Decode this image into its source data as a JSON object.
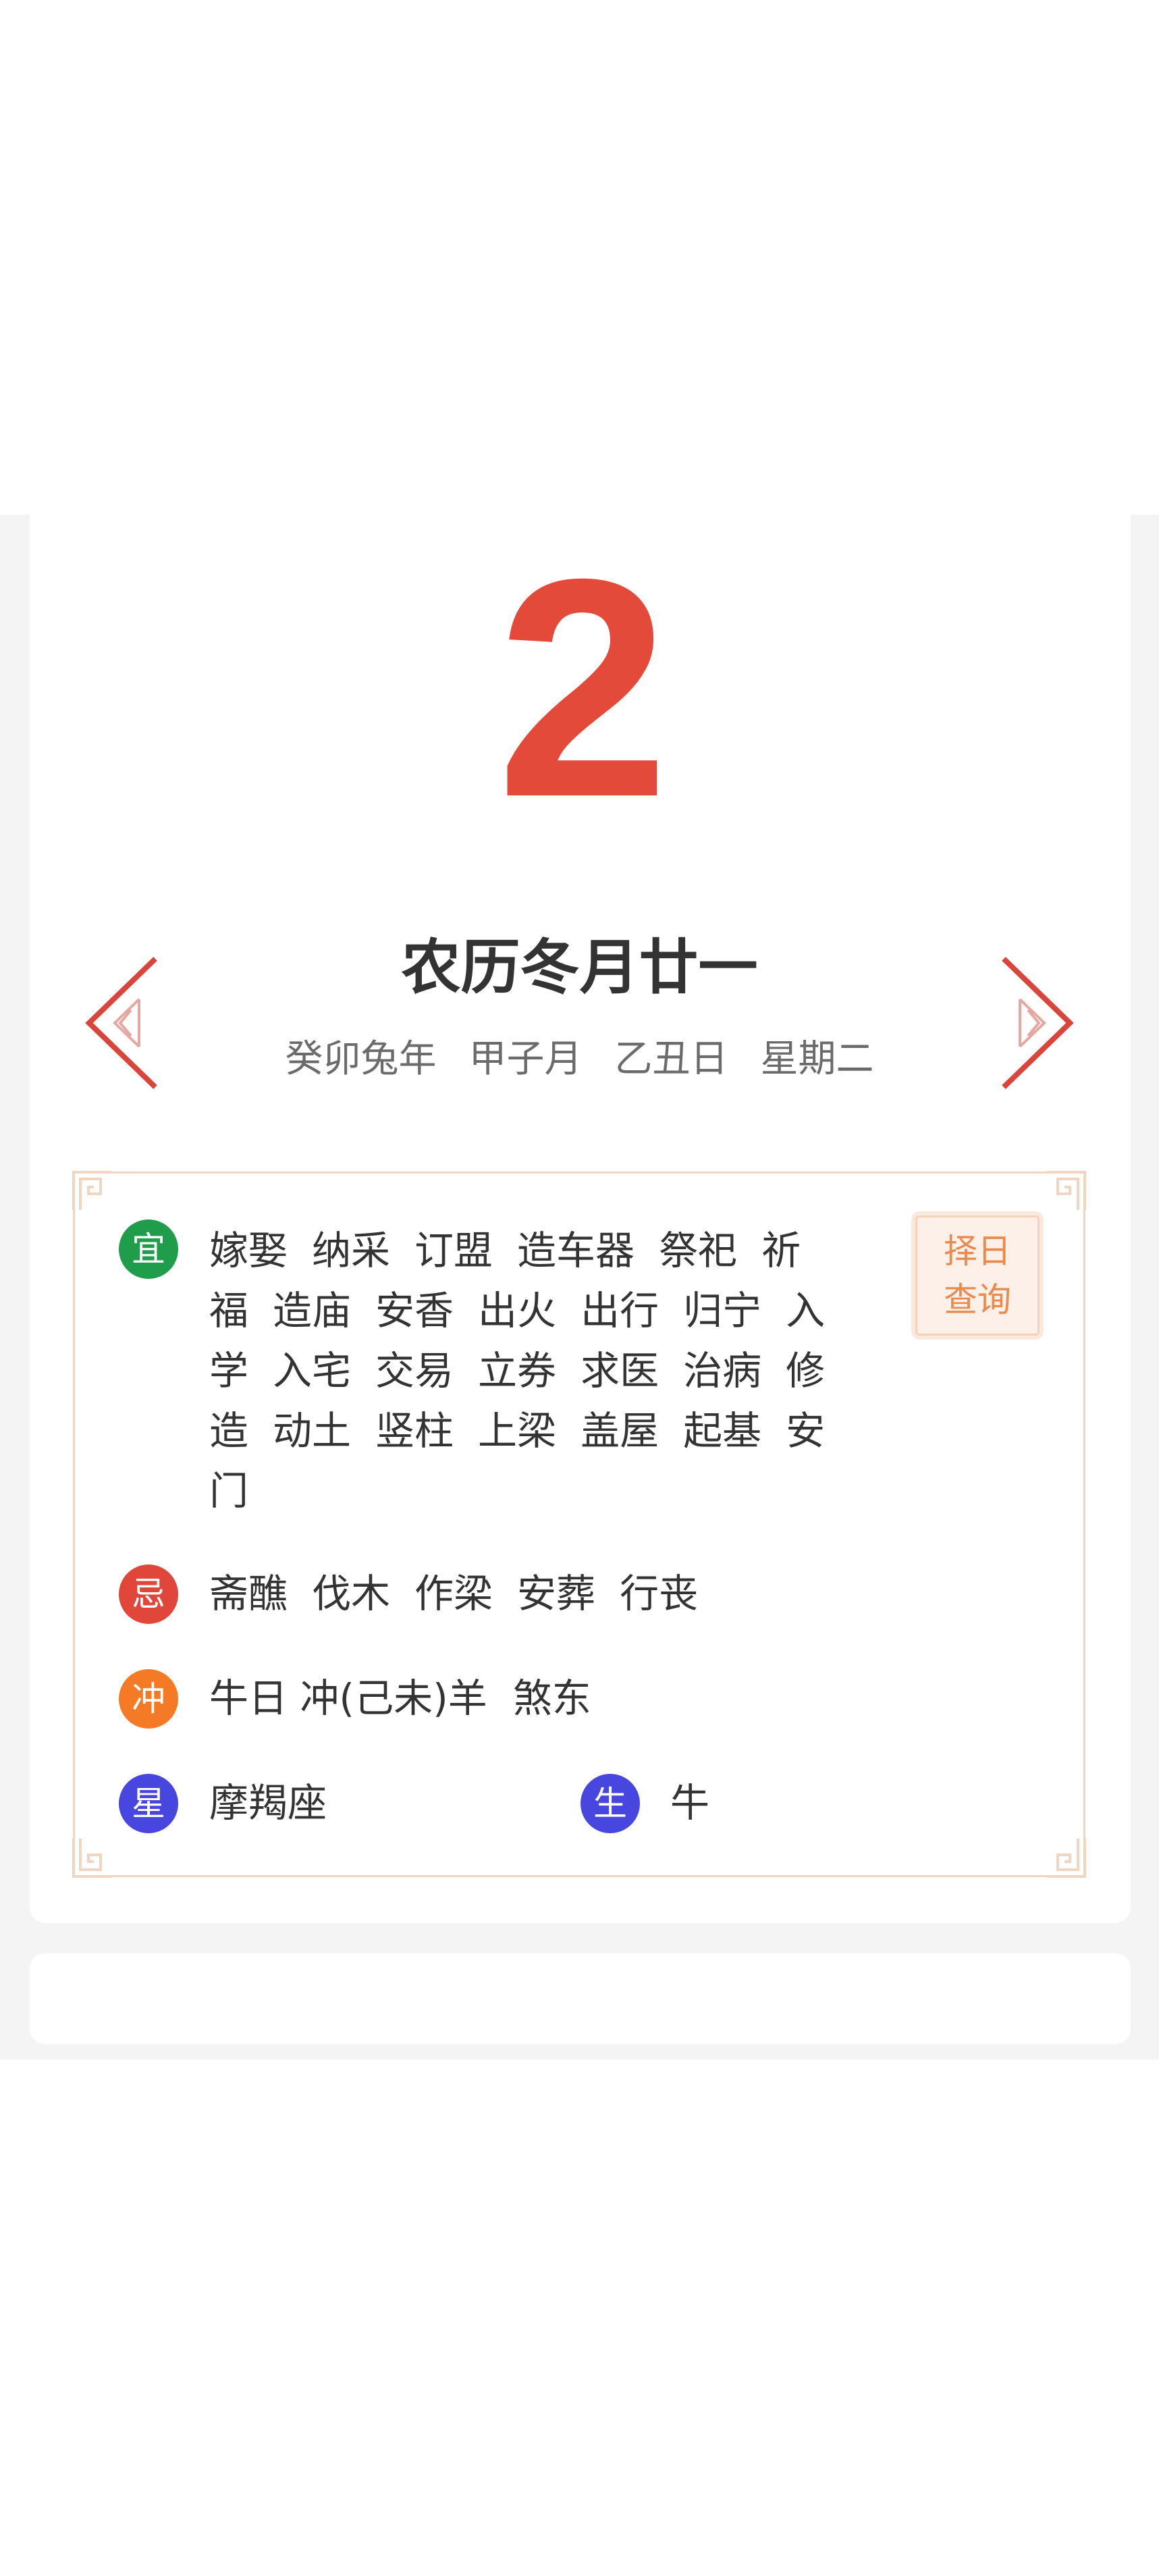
{
  "day": {
    "number": "2",
    "lunar_date": "农历冬月廿一",
    "ganzhi": [
      "癸卯兔年",
      "甲子月",
      "乙丑日",
      "星期二"
    ]
  },
  "almanac": {
    "yi": {
      "badge": "宜",
      "items": [
        "嫁娶",
        "纳采",
        "订盟",
        "造车器",
        "祭祀",
        "祈福",
        "造庙",
        "安香",
        "出火",
        "出行",
        "归宁",
        "入学",
        "入宅",
        "交易",
        "立券",
        "求医",
        "治病",
        "修造",
        "动土",
        "竖柱",
        "上梁",
        "盖屋",
        "起基",
        "安门"
      ]
    },
    "ji": {
      "badge": "忌",
      "items": [
        "斋醮",
        "伐木",
        "作梁",
        "安葬",
        "行丧"
      ]
    },
    "chong": {
      "badge": "冲",
      "text": "牛日 冲(己未)羊",
      "sha": "煞东"
    },
    "xing": {
      "badge": "星",
      "text": "摩羯座"
    },
    "sheng": {
      "badge": "生",
      "text": "牛"
    },
    "select_day_button": "择日查询"
  },
  "colors": {
    "accent_red": "#e44a3a",
    "yi_green": "#1f9d4a",
    "ji_red": "#e0473a",
    "chong_orange": "#f47a25",
    "star_blue": "#4747e0",
    "button_orange": "#e98a4e"
  },
  "icons": {
    "prev": "chevron-left-icon",
    "next": "chevron-right-icon",
    "frame_corner": "fret-corner-ornament"
  }
}
